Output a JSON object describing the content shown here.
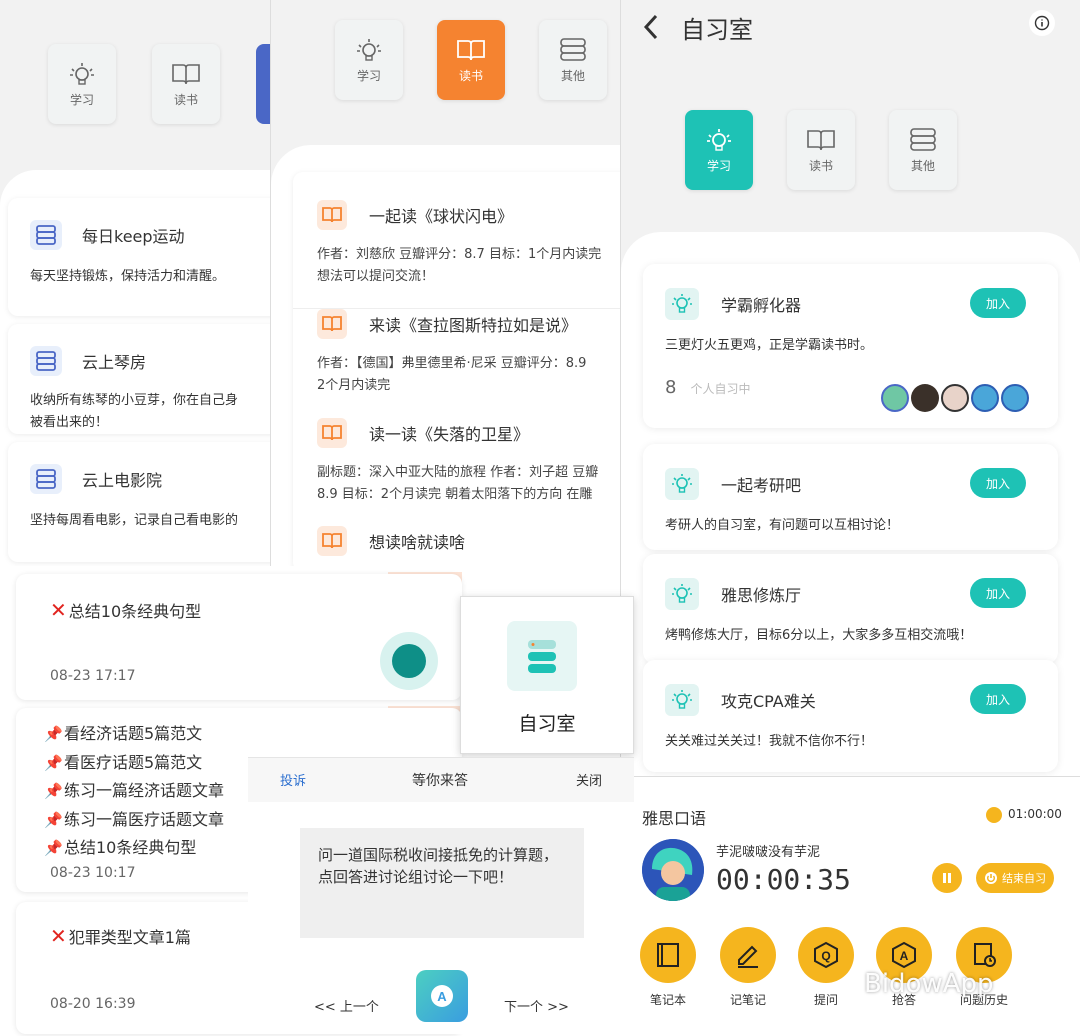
{
  "colors": {
    "teal": "#1ec2b5",
    "orange": "#f58330",
    "blue": "#4a67c6",
    "gold": "#f5b51e",
    "red": "#e1241f"
  },
  "panel_a": {
    "tabs": [
      {
        "label": "学习",
        "icon": "lightbulb-icon"
      },
      {
        "label": "读书",
        "icon": "book-icon"
      }
    ],
    "cards": [
      {
        "title": "每日keep运动",
        "desc": "每天坚持锻炼，保持活力和清醒。",
        "icon": "stack-icon"
      },
      {
        "title": "云上琴房",
        "desc": "收纳所有练琴的小豆芽，你在自己身",
        "desc2": "被看出来的！",
        "icon": "stack-icon"
      },
      {
        "title": "云上电影院",
        "desc": "坚持每周看电影，记录自己看电影的",
        "icon": "stack-icon"
      }
    ]
  },
  "panel_b": {
    "tabs": [
      {
        "label": "学习",
        "icon": "lightbulb-icon"
      },
      {
        "label": "读书",
        "icon": "book-icon"
      },
      {
        "label": "其他",
        "icon": "stack-icon"
      }
    ],
    "cards": [
      {
        "title": "一起读《球状闪电》",
        "l1": "作者：刘慈欣 豆瓣评分：8.7 目标：1个月内读完",
        "l2": "想法可以提问交流！"
      },
      {
        "title": "来读《查拉图斯特拉如是说》",
        "l1": "作者：【德国】弗里德里希·尼采 豆瓣评分：8.9",
        "l2": "2个月内读完"
      },
      {
        "title": "读一读《失落的卫星》",
        "l1": "副标题：深入中亚大陆的旅程 作者：刘子超 豆瓣",
        "l2": "8.9 目标：2个月读完 朝着太阳落下的方向 在雕"
      },
      {
        "title": "想读啥就读啥",
        "l1": "",
        "l2": ""
      }
    ]
  },
  "panel_c": {
    "back_label": "<",
    "title": "自习室",
    "info_icon": "info-icon",
    "tabs": [
      {
        "label": "学习",
        "icon": "lightbulb-icon"
      },
      {
        "label": "读书",
        "icon": "book-icon"
      },
      {
        "label": "其他",
        "icon": "stack-icon"
      }
    ],
    "rooms": [
      {
        "title": "学霸孵化器",
        "desc": "三更灯火五更鸡，正是学霸读书时。",
        "count": "8",
        "count_label": "个人自习中",
        "join": "加入"
      },
      {
        "title": "一起考研吧",
        "desc": "考研人的自习室，有问题可以互相讨论！",
        "join": "加入"
      },
      {
        "title": "雅思修炼厅",
        "desc": "烤鸭修炼大厅，目标6分以上，大家多多互相交流哦！",
        "join": "加入"
      },
      {
        "title": "攻克CPA难关",
        "desc": "关关难过关关过！我就不信你不行！",
        "join": "加入"
      }
    ]
  },
  "panel_d": {
    "room_name": "雅思口语",
    "countdown": "01:00:00",
    "user_name": "芋泥啵啵没有芋泥",
    "timer": "00:00:35",
    "end_label": "结束自习",
    "tools": [
      {
        "label": "笔记本",
        "icon": "notebook-icon"
      },
      {
        "label": "记笔记",
        "icon": "pen-note-icon"
      },
      {
        "label": "提问",
        "icon": "question-icon"
      },
      {
        "label": "抢答",
        "icon": "answer-icon"
      },
      {
        "label": "问题历史",
        "icon": "history-icon"
      }
    ]
  },
  "tasks": [
    {
      "mark": "cross",
      "lines": [
        "总结10条经典句型"
      ],
      "date": "08-23 17:17"
    },
    {
      "mark": "pin",
      "lines": [
        "看经济话题5篇范文",
        "看医疗话题5篇范文",
        "练习一篇经济话题文章",
        "练习一篇医疗话题文章",
        "总结10条经典句型"
      ],
      "date": "08-23 10:17"
    },
    {
      "mark": "cross",
      "lines": [
        "犯罪类型文章1篇"
      ],
      "date": "08-20 16:39"
    }
  ],
  "room_tile": {
    "label": "自习室"
  },
  "dialog": {
    "report": "投诉",
    "title": "等你来答",
    "close": "关闭",
    "question": "问一道国际税收间接抵免的计算题，点回答进讨论组讨论一下吧！",
    "prev": "<< 上一个",
    "next": "下一个 >>"
  },
  "watermark": "BidowApp"
}
